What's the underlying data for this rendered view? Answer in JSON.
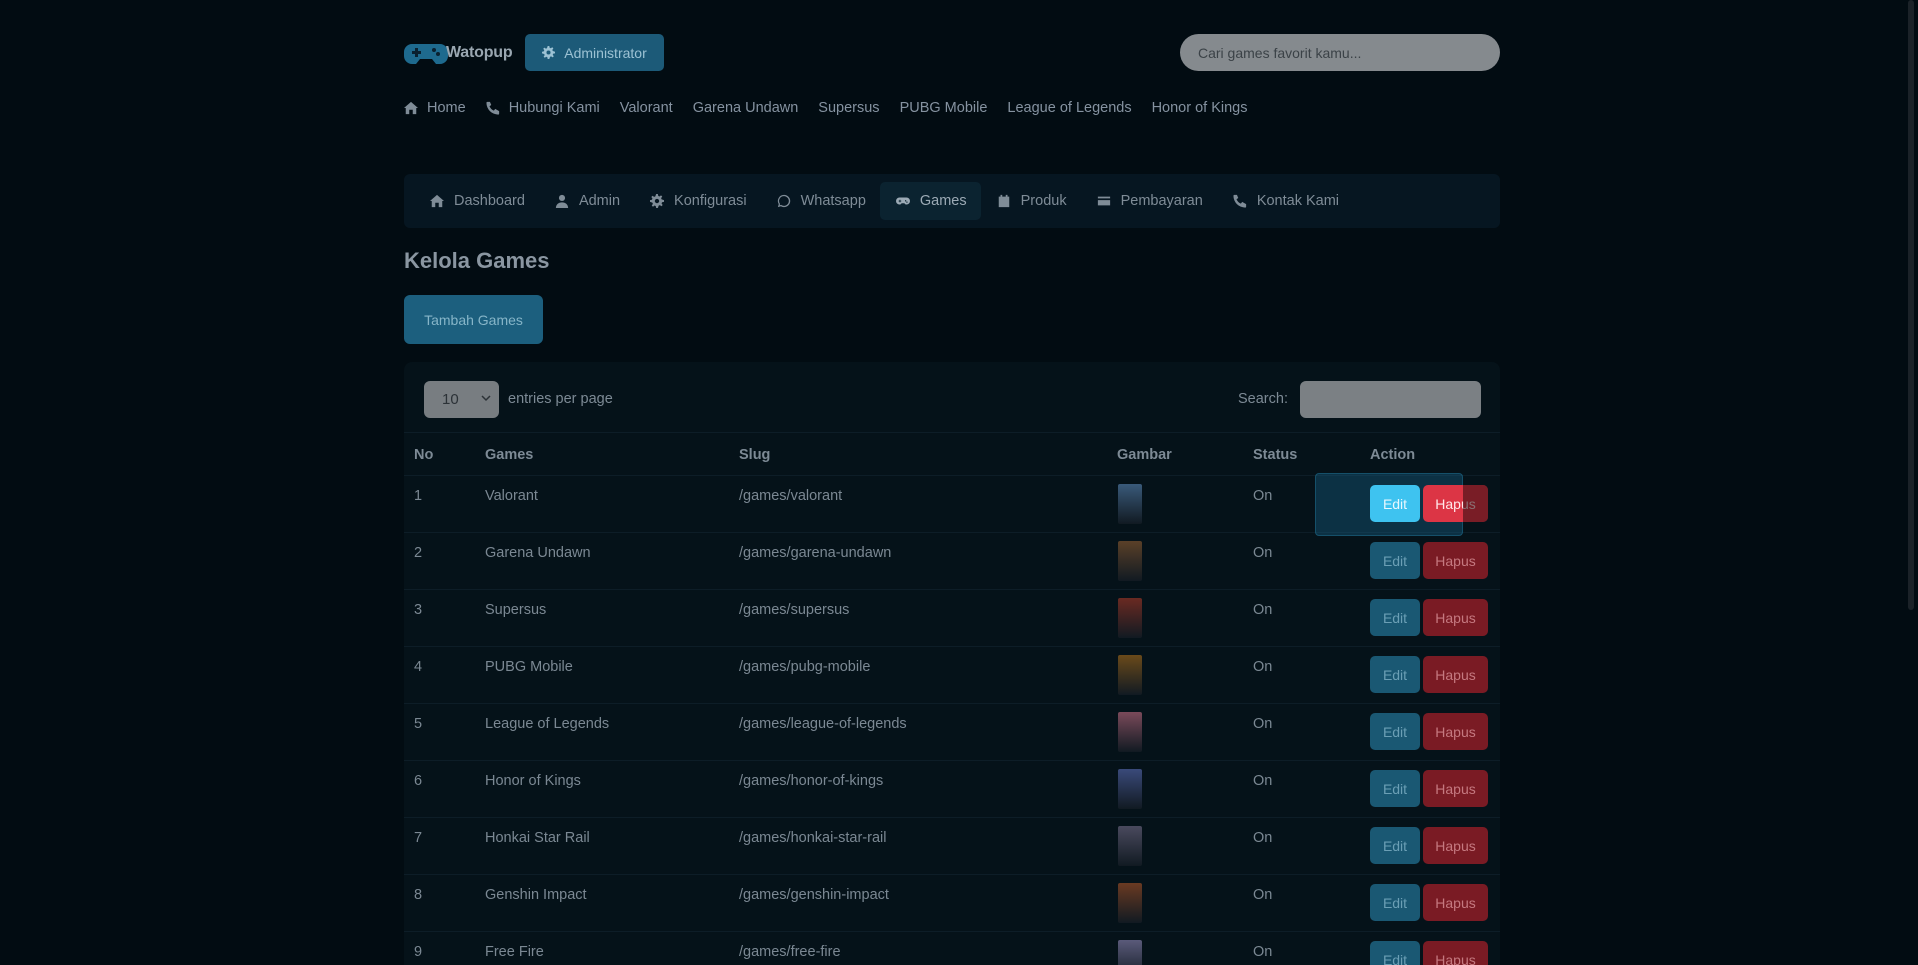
{
  "brand": {
    "name": "Watopup"
  },
  "header": {
    "admin_label": "Administrator",
    "search_placeholder": "Cari games favorit kamu..."
  },
  "main_nav": [
    {
      "label": "Home",
      "icon": "home-icon"
    },
    {
      "label": "Hubungi Kami",
      "icon": "phone-icon"
    },
    {
      "label": "Valorant"
    },
    {
      "label": "Garena Undawn"
    },
    {
      "label": "Supersus"
    },
    {
      "label": "PUBG Mobile"
    },
    {
      "label": "League of Legends"
    },
    {
      "label": "Honor of Kings"
    }
  ],
  "admin_nav": [
    {
      "label": "Dashboard",
      "icon": "home-icon"
    },
    {
      "label": "Admin",
      "icon": "user-icon"
    },
    {
      "label": "Konfigurasi",
      "icon": "gear-icon"
    },
    {
      "label": "Whatsapp",
      "icon": "whatsapp-icon"
    },
    {
      "label": "Games",
      "icon": "gamepad-icon",
      "active": true
    },
    {
      "label": "Produk",
      "icon": "calendar-icon"
    },
    {
      "label": "Pembayaran",
      "icon": "credit-card-icon"
    },
    {
      "label": "Kontak Kami",
      "icon": "phone-icon"
    }
  ],
  "page": {
    "title": "Kelola Games",
    "add_button": "Tambah Games"
  },
  "table": {
    "length_value": "10",
    "length_label": "entries per page",
    "search_label": "Search:",
    "columns": [
      "No",
      "Games",
      "Slug",
      "Gambar",
      "Status",
      "Action"
    ],
    "edit_label": "Edit",
    "delete_label": "Hapus",
    "rows": [
      {
        "no": "1",
        "game": "Valorant",
        "slug": "/games/valorant",
        "status": "On",
        "thumb_color": "#3a5a7a"
      },
      {
        "no": "2",
        "game": "Garena Undawn",
        "slug": "/games/garena-undawn",
        "status": "On",
        "thumb_color": "#5a4028"
      },
      {
        "no": "3",
        "game": "Supersus",
        "slug": "/games/supersus",
        "status": "On",
        "thumb_color": "#6a2a22"
      },
      {
        "no": "4",
        "game": "PUBG Mobile",
        "slug": "/games/pubg-mobile",
        "status": "On",
        "thumb_color": "#6a4a1a"
      },
      {
        "no": "5",
        "game": "League of Legends",
        "slug": "/games/league-of-legends",
        "status": "On",
        "thumb_color": "#7a4a5a"
      },
      {
        "no": "6",
        "game": "Honor of Kings",
        "slug": "/games/honor-of-kings",
        "status": "On",
        "thumb_color": "#3a4a7a"
      },
      {
        "no": "7",
        "game": "Honkai Star Rail",
        "slug": "/games/honkai-star-rail",
        "status": "On",
        "thumb_color": "#4a4a5e"
      },
      {
        "no": "8",
        "game": "Genshin Impact",
        "slug": "/games/genshin-impact",
        "status": "On",
        "thumb_color": "#6a3a22"
      },
      {
        "no": "9",
        "game": "Free Fire",
        "slug": "/games/free-fire",
        "status": "On",
        "thumb_color": "#5a5a7a"
      }
    ]
  },
  "colors": {
    "background": "#020c12",
    "accent": "#1c5a78",
    "edit_active": "#3ec3f0",
    "delete_active": "#dc3545"
  }
}
